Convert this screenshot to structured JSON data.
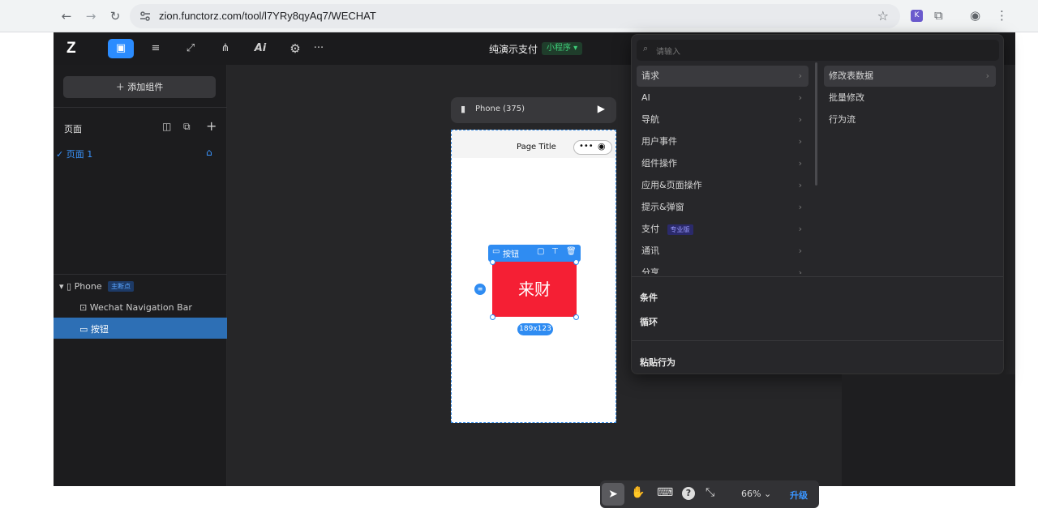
{
  "browser": {
    "url": "zion.functorz.com/tool/l7YRy8qyAq7/WECHAT",
    "back_icon": "←",
    "forward_icon": "→",
    "reload_icon": "↻"
  },
  "topbar": {
    "logo": "Z",
    "project_title": "纯演示支付",
    "platform_badge": "小程序",
    "ai_label": "Ai",
    "more_label": "···"
  },
  "left": {
    "add_component": "添加组件",
    "pages_title": "页面",
    "page1": "页面 1",
    "tree": {
      "phone": "Phone",
      "phone_badge": "主断点",
      "navbar": "Wechat Navigation Bar",
      "button": "按钮"
    }
  },
  "canvas": {
    "phone_label": "Phone (375)",
    "page_title": "Page Title",
    "button_toolbar_label": "按钮",
    "button_text": "来财",
    "dimensions": "189x123"
  },
  "bottom": {
    "zoom": "66%",
    "upgrade": "升级"
  },
  "menu": {
    "search_placeholder": "请输入",
    "items": [
      "请求",
      "AI",
      "导航",
      "用户事件",
      "组件操作",
      "应用&页面操作",
      "提示&弹窗",
      "支付",
      "通讯",
      "分享"
    ],
    "pay_badge": "专业版",
    "sub_items": [
      "修改表数据",
      "批量修改",
      "行为流"
    ],
    "condition": "条件",
    "loop": "循环",
    "paste": "粘贴行为"
  },
  "colors": {
    "accent": "#2b8cff",
    "button_red": "#f51f34",
    "badge_green": "#2a9d5c"
  }
}
